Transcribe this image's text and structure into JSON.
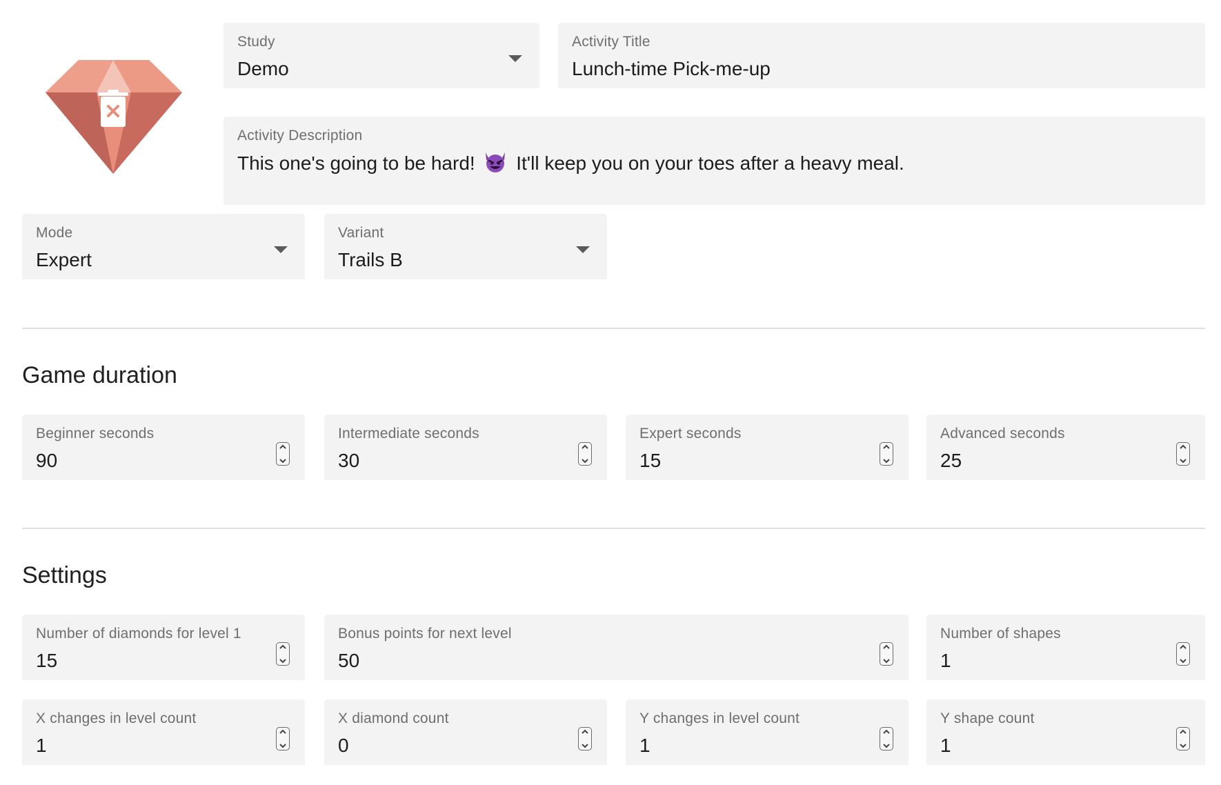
{
  "header": {
    "study": {
      "label": "Study",
      "value": "Demo"
    },
    "title": {
      "label": "Activity Title",
      "value": "Lunch-time Pick-me-up"
    },
    "description": {
      "label": "Activity Description",
      "text_before": "This one's going to be hard!",
      "text_after": "It'll keep you on your toes after a heavy meal."
    },
    "mode": {
      "label": "Mode",
      "value": "Expert"
    },
    "variant": {
      "label": "Variant",
      "value": "Trails B"
    }
  },
  "game_duration": {
    "title": "Game duration",
    "fields": [
      {
        "label": "Beginner seconds",
        "value": "90"
      },
      {
        "label": "Intermediate seconds",
        "value": "30"
      },
      {
        "label": "Expert seconds",
        "value": "15"
      },
      {
        "label": "Advanced seconds",
        "value": "25"
      }
    ]
  },
  "settings": {
    "title": "Settings",
    "row1": [
      {
        "label": "Number of diamonds for level 1",
        "value": "15"
      },
      {
        "label": "Bonus points for next level",
        "value": "50"
      },
      {
        "label": "Number of shapes",
        "value": "1"
      }
    ],
    "row2": [
      {
        "label": "X changes in level count",
        "value": "1"
      },
      {
        "label": "X diamond count",
        "value": "0"
      },
      {
        "label": "Y changes in level count",
        "value": "1"
      },
      {
        "label": "Y shape count",
        "value": "1"
      }
    ]
  },
  "icons": {
    "avatar": "diamond-delete-icon",
    "description_emoji": "smiling-devil-emoji"
  },
  "colors": {
    "diamond_light": "#f0a590",
    "diamond_mid": "#e08670",
    "diamond_dark": "#c0665a",
    "field_bg": "#f3f3f3"
  }
}
